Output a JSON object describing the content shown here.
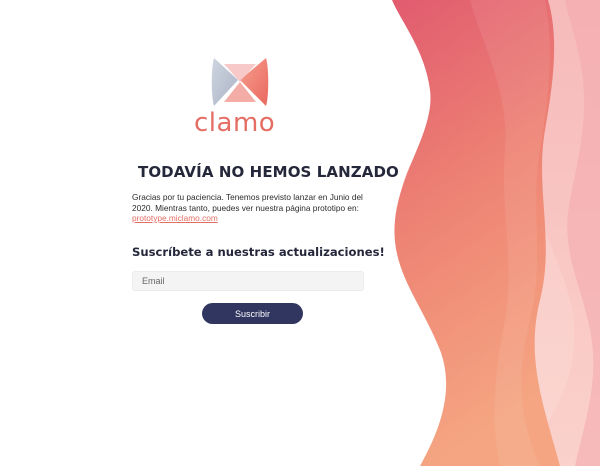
{
  "brand": {
    "name": "clamo",
    "logo_icon": "clamo-bow-logo-icon",
    "brand_color": "#e56e64"
  },
  "headline": {
    "icon": "construction-sign-icon",
    "text": "TODAVÍA NO HEMOS LANZADO"
  },
  "description": {
    "text": "Gracias por tu paciencia. Tenemos previsto lanzar en Junio del 2020. Mientras tanto, puedes ver nuestra página prototipo en:",
    "link_text": "prototype.miclamo.com"
  },
  "subscribe": {
    "title": "Suscríbete a nuestras actualizaciones!",
    "email_placeholder": "Email",
    "button_label": "Suscribir",
    "button_color": "#313660"
  },
  "background": {
    "wave_colors": [
      "#e4606f",
      "#f39e7f",
      "#f7c2c1"
    ]
  }
}
